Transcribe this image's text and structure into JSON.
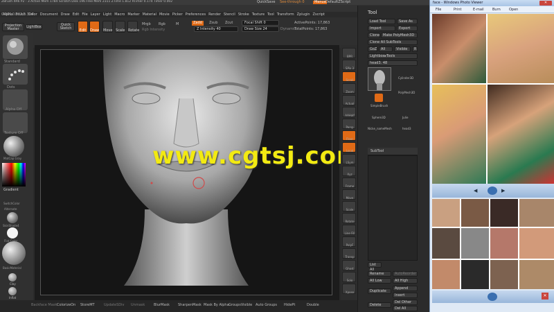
{
  "app": {
    "title_text": "ZBrush 4R6 P2 - 3  Active Mem 1784  Scratch Disk 196  Free Mem 2311  ZTime 1.812  RTimer 0.174  Timer 0.002",
    "quicksave": "QuickSave",
    "seethrough": "See-through  0",
    "menus_label": "Menus",
    "script_label": "DefaultZScript",
    "coords": "0.000,0.002,0.304"
  },
  "menubar": [
    "Alpha",
    "Brush",
    "Color",
    "Document",
    "Draw",
    "Edit",
    "File",
    "Layer",
    "Light",
    "Macro",
    "Marker",
    "Material",
    "Movie",
    "Picker",
    "Preferences",
    "Render",
    "Stencil",
    "Stroke",
    "Texture",
    "Tool",
    "Transform",
    "Zplugin",
    "Zscript"
  ],
  "top_shelf": {
    "projection_master": "Projection Master",
    "lightbox": "LightBox",
    "quick_sketch": "Quick Sketch",
    "modes": [
      "Edit",
      "Draw",
      "Move",
      "Scale",
      "Rotate"
    ],
    "mrgb": "Mrgb",
    "rgb": "Rgb",
    "m": "M",
    "rgb_intensity": "Rgb Intensity",
    "zadd": "Zadd",
    "zsub": "Zsub",
    "zcut": "Zcut",
    "z_intensity": "Z Intensity 40",
    "focal_shift": "Focal Shift 0",
    "draw_size": "Draw Size 24",
    "dynamic": "Dynamic",
    "active_points": "ActivePoints: 17,863",
    "total_points": "TotalPoints: 17,863"
  },
  "left_panel": {
    "brush": "Standard",
    "stroke": "Dots",
    "alpha": "Alpha Off",
    "texture": "Texture Off",
    "material": "MatCap Gray",
    "gradient": "Gradient",
    "switch": "SwitchColor",
    "alternate": "Alternate",
    "materials": [
      "SkinShade4",
      "Flat Color",
      "BasicMaterial"
    ],
    "tools": [
      "Clay",
      "Inflat",
      "TrimDynamic"
    ]
  },
  "right_shelf": [
    "BPR",
    "SPix 3",
    "Scroll",
    "Zoom",
    "Actual",
    "AAHalf",
    "Persp",
    "Floor",
    "Local",
    "LSym",
    "Xyz",
    "Frame",
    "Move",
    "Scale",
    "Rotate",
    "Line Fill",
    "PolyF",
    "Transp",
    "Ghost",
    "Solo",
    "Xpose"
  ],
  "tool_panel": {
    "title": "Tool",
    "load_tool": "Load Tool",
    "save_as": "Save As",
    "import": "Import",
    "export": "Export",
    "clone": "Clone",
    "make_polymesh": "Make PolyMesh3D",
    "clone_all": "Clone All SubTools",
    "goz": "GoZ",
    "all": "All",
    "visible": "Visible",
    "r": "R",
    "lightbox_tools": "Lightbox▸Tools",
    "current_tool": "head3. 48",
    "tool_items": [
      "head3",
      "Cylinder3D",
      "PolyMesh3D",
      "SimpleBrush",
      "Sphere3D",
      "Julie",
      "Nicke_nameMesh",
      "head3"
    ],
    "subtool": "SubTool",
    "list_all": "List All",
    "rename": "Rename",
    "autoreorder": "AutoReorder",
    "all_low": "All Low",
    "all_high": "All High",
    "duplicate": "Duplicate",
    "append": "Append",
    "insert": "Insert",
    "delete": "Delete",
    "del_other": "Del Other",
    "del_all": "Del All"
  },
  "bottom_bar": [
    "Backface Mask",
    "ColorizeOn",
    "StoreMT",
    "UpdateSDiv",
    "Unmask",
    "BlurMask",
    "SharpenMask",
    "Mask By Alpha",
    "GroupsVisible",
    "Auto Groups",
    "HidePt",
    "Double"
  ],
  "photo_viewer": {
    "title": "face - Windows Photo Viewer",
    "menu": [
      "File",
      "Print",
      "E-mail",
      "Burn",
      "Open"
    ]
  },
  "watermark": "www.cgtsj.com",
  "colors": {
    "accent": "#e06a16",
    "watermark": "#f2ea12"
  }
}
